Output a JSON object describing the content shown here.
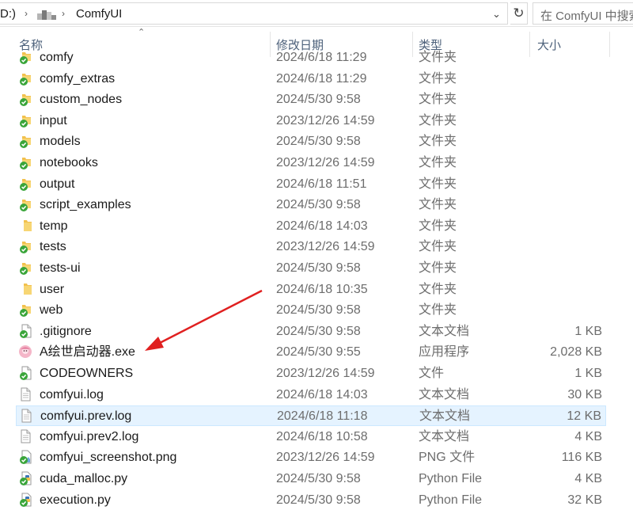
{
  "address": {
    "drive": "D:)",
    "folder": "ComfyUI",
    "search_placeholder": "在 ComfyUI 中搜索"
  },
  "columns": {
    "name": "名称",
    "date": "修改日期",
    "type": "类型",
    "size": "大小"
  },
  "files": [
    {
      "name": "comfy",
      "date": "2024/6/18 11:29",
      "type": "文件夹",
      "size": "",
      "icon": "folder-sync-icon"
    },
    {
      "name": "comfy_extras",
      "date": "2024/6/18 11:29",
      "type": "文件夹",
      "size": "",
      "icon": "folder-sync-icon"
    },
    {
      "name": "custom_nodes",
      "date": "2024/5/30 9:58",
      "type": "文件夹",
      "size": "",
      "icon": "folder-sync-icon"
    },
    {
      "name": "input",
      "date": "2023/12/26 14:59",
      "type": "文件夹",
      "size": "",
      "icon": "folder-sync-icon"
    },
    {
      "name": "models",
      "date": "2024/5/30 9:58",
      "type": "文件夹",
      "size": "",
      "icon": "folder-sync-icon"
    },
    {
      "name": "notebooks",
      "date": "2023/12/26 14:59",
      "type": "文件夹",
      "size": "",
      "icon": "folder-sync-icon"
    },
    {
      "name": "output",
      "date": "2024/6/18 11:51",
      "type": "文件夹",
      "size": "",
      "icon": "folder-sync-icon"
    },
    {
      "name": "script_examples",
      "date": "2024/5/30 9:58",
      "type": "文件夹",
      "size": "",
      "icon": "folder-sync-icon"
    },
    {
      "name": "temp",
      "date": "2024/6/18 14:03",
      "type": "文件夹",
      "size": "",
      "icon": "folder-icon"
    },
    {
      "name": "tests",
      "date": "2023/12/26 14:59",
      "type": "文件夹",
      "size": "",
      "icon": "folder-sync-icon"
    },
    {
      "name": "tests-ui",
      "date": "2024/5/30 9:58",
      "type": "文件夹",
      "size": "",
      "icon": "folder-sync-icon"
    },
    {
      "name": "user",
      "date": "2024/6/18 10:35",
      "type": "文件夹",
      "size": "",
      "icon": "folder-icon"
    },
    {
      "name": "web",
      "date": "2024/5/30 9:58",
      "type": "文件夹",
      "size": "",
      "icon": "folder-sync-icon"
    },
    {
      "name": ".gitignore",
      "date": "2024/5/30 9:58",
      "type": "文本文档",
      "size": "1 KB",
      "icon": "file-sync-icon"
    },
    {
      "name": "A绘世启动器.exe",
      "date": "2024/5/30 9:55",
      "type": "应用程序",
      "size": "2,028 KB",
      "icon": "app-icon"
    },
    {
      "name": "CODEOWNERS",
      "date": "2023/12/26 14:59",
      "type": "文件",
      "size": "1 KB",
      "icon": "file-sync-icon"
    },
    {
      "name": "comfyui.log",
      "date": "2024/6/18 14:03",
      "type": "文本文档",
      "size": "30 KB",
      "icon": "file-icon"
    },
    {
      "name": "comfyui.prev.log",
      "date": "2024/6/18 11:18",
      "type": "文本文档",
      "size": "12 KB",
      "icon": "file-icon",
      "selected": true
    },
    {
      "name": "comfyui.prev2.log",
      "date": "2024/6/18 10:58",
      "type": "文本文档",
      "size": "4 KB",
      "icon": "file-icon"
    },
    {
      "name": "comfyui_screenshot.png",
      "date": "2023/12/26 14:59",
      "type": "PNG 文件",
      "size": "116 KB",
      "icon": "image-sync-icon"
    },
    {
      "name": "cuda_malloc.py",
      "date": "2024/5/30 9:58",
      "type": "Python File",
      "size": "4 KB",
      "icon": "python-sync-icon"
    },
    {
      "name": "execution.py",
      "date": "2024/5/30 9:58",
      "type": "Python File",
      "size": "32 KB",
      "icon": "python-sync-icon"
    }
  ],
  "colors": {
    "selection": "#e5f3ff",
    "annotation_arrow": "#e02020",
    "sync_green": "#3aa53a",
    "folder_yellow": "#f2c14e"
  }
}
